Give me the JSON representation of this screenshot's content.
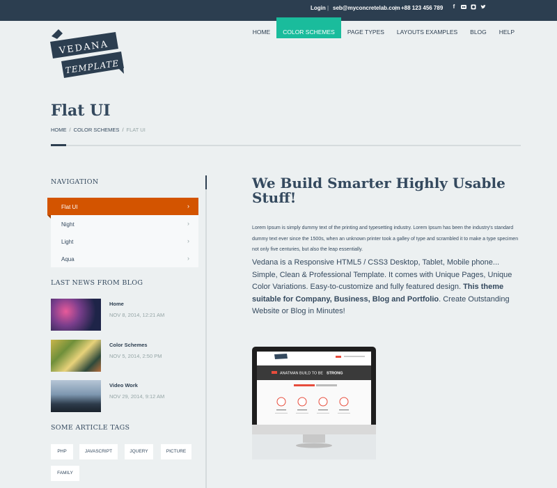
{
  "topbar": {
    "login": "Login",
    "sep": "|",
    "email": "seb@myconcretelab.com",
    "phone": "+88 123 456 789",
    "social": [
      "facebook-icon",
      "flickr-icon",
      "github-icon",
      "twitter-icon"
    ]
  },
  "logo": {
    "line1": "VEDANA",
    "line2": "TEMPLATE"
  },
  "nav": {
    "items": [
      "HOME",
      "COLOR SCHEMES",
      "PAGE TYPES",
      "LAYOUTS EXAMPLES",
      "BLOG",
      "HELP"
    ],
    "active_index": 1
  },
  "page": {
    "title": "Flat UI",
    "breadcrumb": [
      "HOME",
      "COLOR SCHEMES",
      "FLAT UI"
    ],
    "breadcrumb_sep": "/"
  },
  "sidebar": {
    "navigation_heading": "NAVIGATION",
    "menu": [
      {
        "label": "Flat UI",
        "chev": "›"
      },
      {
        "label": "Night",
        "chev": "›"
      },
      {
        "label": "Light",
        "chev": "›"
      },
      {
        "label": "Aqua",
        "chev": "›"
      }
    ],
    "news_heading": "LAST NEWS FROM BLOG",
    "news": [
      {
        "title": "Home",
        "date": "NOV 8, 2014, 12:21 AM"
      },
      {
        "title": "Color Schemes",
        "date": "NOV 5, 2014, 2:50 PM"
      },
      {
        "title": "Video Work",
        "date": "NOV 29, 2014, 9:12 AM"
      }
    ],
    "tags_heading": "SOME ARTICLE TAGS",
    "tags": [
      "PHP",
      "JAVASCRIPT",
      "JQUERY",
      "PICTURE",
      "FAMILY"
    ]
  },
  "main": {
    "heading": "We Build Smarter Highly Usable Stuff!",
    "lorem": "Lorem Ipsum is simply dummy text of the printing and typesetting industry. Lorem Ipsum has been the industry's standard dummy text ever since the 1500s, when an unknown printer took a galley of type and scrambled it to make a type specimen not only five centuries, but also the leap essentially.",
    "lead_start": "Vedana is a Responsive HTML5 / CSS3 Desktop, Tablet, Mobile phone... Simple, Clean & Professional Template. It comes with Unique Pages, Unique Color Variations. Easy-to-customize and fully featured design. ",
    "lead_bold": "This theme suitable for Company, Business, Blog and Portfolio",
    "lead_end": ". Create Outstanding Website or Blog in Minutes!",
    "screen_text_a": "ANATMAN BUILD TO BE",
    "screen_text_b": "STRONG"
  },
  "colors": {
    "topbar": "#2c3e50",
    "accent_nav": "#1abc9c",
    "accent_menu": "#d35400",
    "background": "#ecf0f1"
  }
}
